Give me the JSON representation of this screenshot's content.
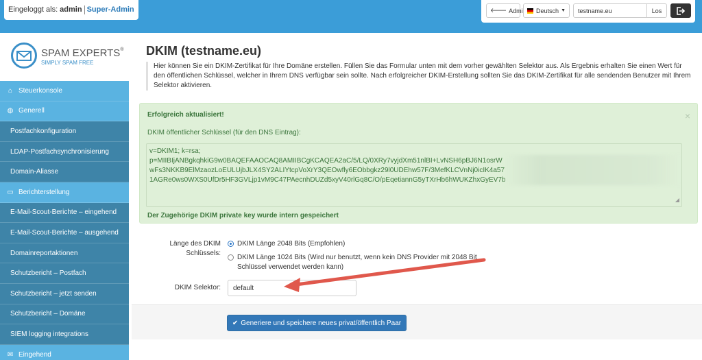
{
  "topbar": {
    "logged_in_label": "Eingeloggt als:",
    "username": "admin",
    "role": "Super-Admin",
    "admin_button": "Admin",
    "language": "Deutsch",
    "domain_value": "testname.eu",
    "go_button": "Los",
    "logout_icon": "logout-icon",
    "colors": {
      "bar": "#3b9dd8"
    }
  },
  "logo": {
    "name": "SPAM EXPERTS",
    "registered": "®",
    "tagline": "SIMPLY SPAM FREE"
  },
  "sidebar": {
    "items": [
      {
        "label": "Steuerkonsole",
        "type": "main",
        "icon": "home-icon"
      },
      {
        "label": "Generell",
        "type": "main",
        "icon": "globe-icon"
      },
      {
        "label": "Postfachkonfiguration",
        "type": "sub"
      },
      {
        "label": "LDAP-Postfachsynchronisierung",
        "type": "sub"
      },
      {
        "label": "Domain-Aliasse",
        "type": "sub"
      },
      {
        "label": "Berichterstellung",
        "type": "main",
        "icon": "report-icon"
      },
      {
        "label": "E-Mail-Scout-Berichte – eingehend",
        "type": "sub"
      },
      {
        "label": "E-Mail-Scout-Berichte – ausgehend",
        "type": "sub"
      },
      {
        "label": "Domainreportaktionen",
        "type": "sub"
      },
      {
        "label": "Schutzbericht – Postfach",
        "type": "sub"
      },
      {
        "label": "Schutzbericht – jetzt senden",
        "type": "sub"
      },
      {
        "label": "Schutzbericht – Domäne",
        "type": "sub"
      },
      {
        "label": "SIEM logging integrations",
        "type": "sub"
      },
      {
        "label": "Eingehend",
        "type": "main",
        "icon": "mail-icon"
      }
    ]
  },
  "main": {
    "title": "DKIM (testname.eu)",
    "description": "Hier können Sie ein DKIM-Zertifikat für Ihre Domäne erstellen. Füllen Sie das Formular unten mit dem vorher gewählten Selektor aus. Als Ergebnis erhalten Sie einen Wert für den öffentlichen Schlüssel, welcher in Ihrem DNS verfügbar sein sollte. Nach erfolgreicher DKIM-Erstellung sollten Sie das DKIM-Zertifikat für alle sendenden Benutzer mit Ihrem Selektor aktivieren.",
    "alert": {
      "title": "Erfolgreich aktualisiert!",
      "close": "×",
      "key_label": "DKIM öffentlicher Schlüssel (für den DNS Eintrag):",
      "key_lines": [
        "v=DKIM1; k=rsa;",
        "p=MIIBIjANBgkqhkiG9w0BAQEFAAOCAQ8AMIIBCgKCAQEA2aC/5/LQ/0XRy7vyjdXm51nlBI+LvNSH6pBJ6N1osrW",
        "wFs3NKKB9ElMzaozLoEULUjbJLX4SY2ALIYtcpVoXrY3QEOwfly6EObbgkz29l0UDEhw57F/3MefKLCVnNj0icIK4a57",
        "1AGRe0ws0WXS0UfDr5HF3GVLjp1vM9C47PAecnhDUZd5xyV40rlGq8C/O/pEqetiannG5yTXrHb6hWUKZhxGyEV7b"
      ],
      "footer": "Der Zugehörige DKIM private key wurde intern gespeichert"
    },
    "form": {
      "length_label": "Länge des DKIM Schlüssels:",
      "option_2048": "DKIM Länge 2048 Bits (Empfohlen)",
      "option_1024": "DKIM Länge 1024 Bits (Wird nur benutzt, wenn kein DNS Provider mit 2048 Bit Schlüssel verwendet werden kann)",
      "selected_option": "2048",
      "selector_label": "DKIM Selektor:",
      "selector_value": "default",
      "submit_label": "Generiere und speichere neues privat/öffentlich Paar"
    }
  }
}
